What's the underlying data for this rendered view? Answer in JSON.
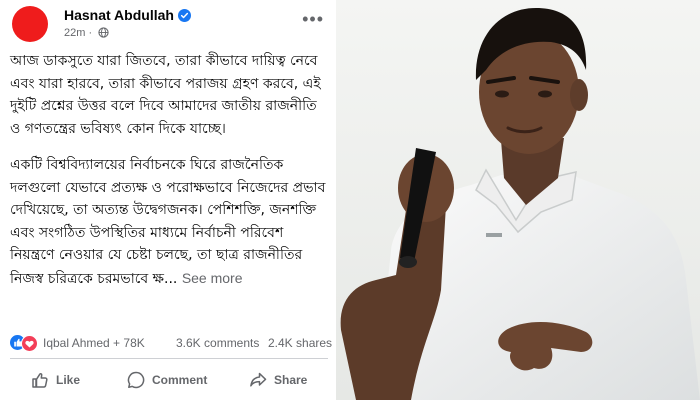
{
  "post": {
    "author": "Hasnat Abdullah",
    "time": "22m",
    "paragraphs": [
      "আজ ডাকসুতে যারা জিতবে, তারা কীভাবে দায়িত্ব নেবে এবং যারা হারবে, তারা কীভাবে পরাজয় গ্রহণ করবে, এই দুইটি প্রশ্নের উত্তর বলে দিবে আমাদের জাতীয় রাজনীতি ও গণতন্ত্রের ভবিষ্যৎ কোন দিকে যাচ্ছে।",
      "একটি বিশ্ববিদ্যালয়ের নির্বাচনকে ঘিরে রাজনৈতিক দলগুলো যেভাবে প্রত্যক্ষ ও পরোক্ষভাবে নিজেদের প্রভাব দেখিয়েছে, তা অত্যন্ত উদ্বেগজনক। পেশিশক্তি, জনশক্তি এবং সংগঠিত উপস্থিতির মাধ্যমে নির্বাচনী পরিবেশ নিয়ন্ত্রণে নেওয়ার যে চেষ্টা চলছে, তা ছাত্র রাজনীতির নিজস্ব চরিত্রকে চরমভাবে ক্ষ..."
    ],
    "see_more": "See more",
    "reactions_summary": "Iqbal Ahmed + 78K",
    "comments": "3.6K comments",
    "shares": "2.4K shares"
  },
  "actions": {
    "like": "Like",
    "comment": "Comment",
    "share": "Share"
  },
  "colors": {
    "avatar": "#ef1c1c",
    "verified": "#1877f2",
    "like_reaction": "#1877f2",
    "love_reaction": "#f33e58"
  },
  "icons": [
    "verified-badge-icon",
    "globe-icon",
    "more-options-icon",
    "like-reaction-icon",
    "love-reaction-icon",
    "thumbs-up-icon",
    "comment-icon",
    "share-icon"
  ]
}
